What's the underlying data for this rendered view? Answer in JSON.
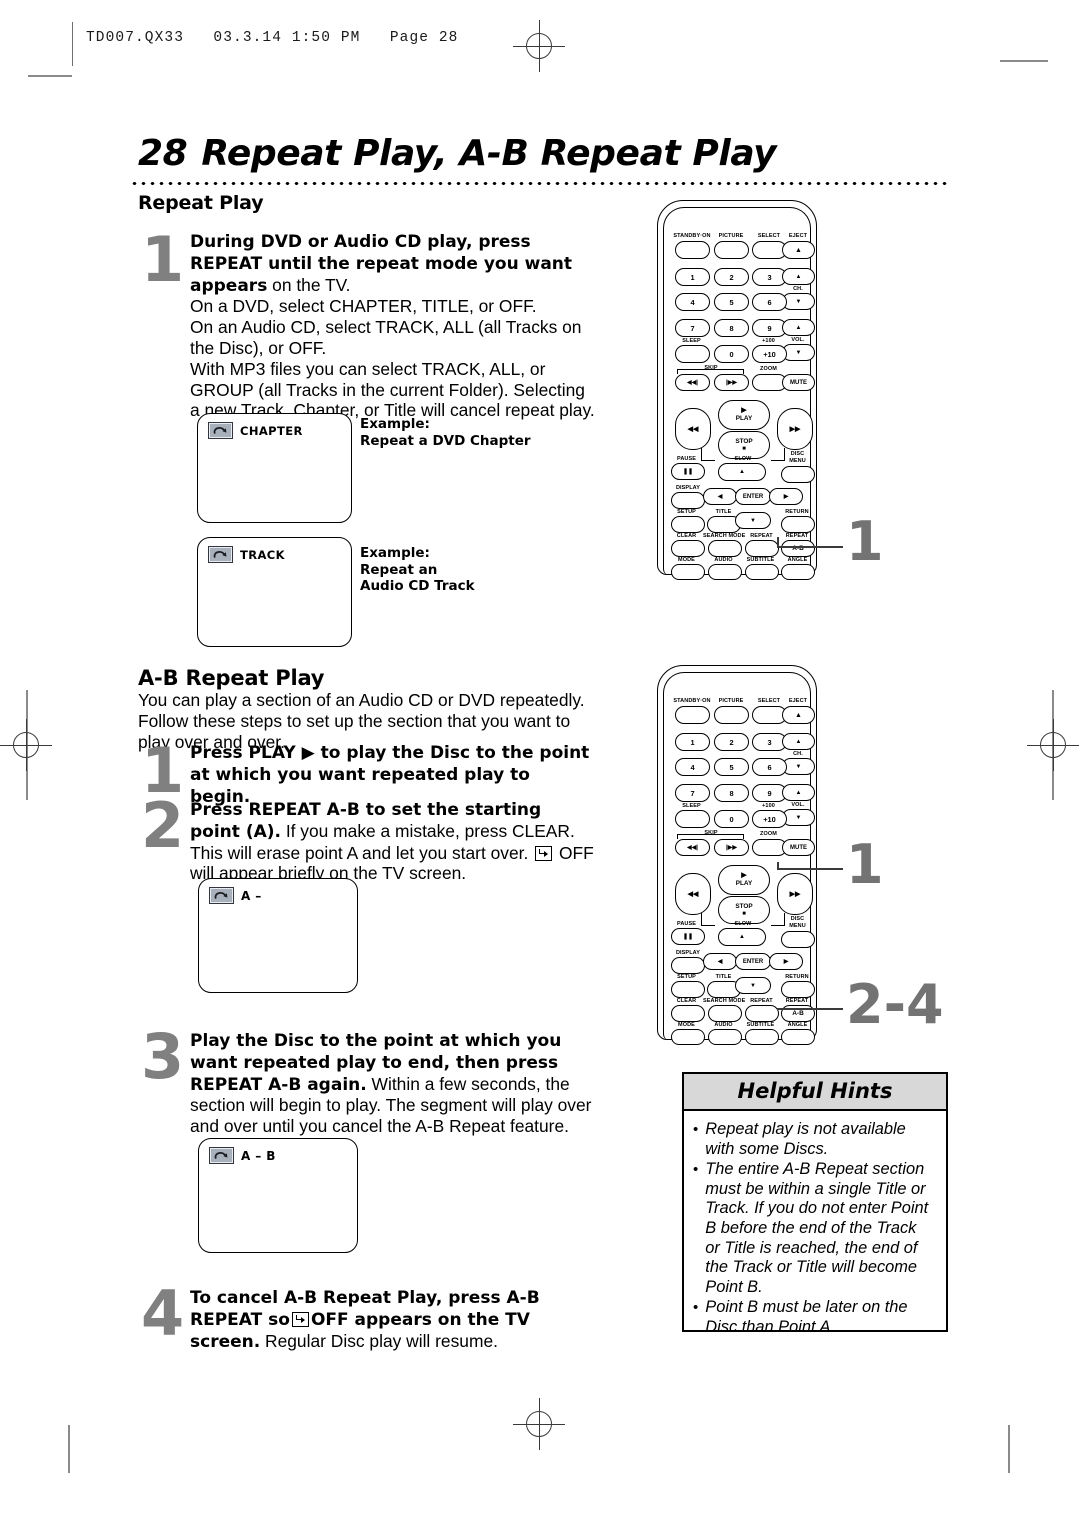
{
  "header": {
    "print_info": "TD007.QX33   03.3.14 1:50 PM   Page 28"
  },
  "page": {
    "number": "28",
    "title": "Repeat Play, A-B Repeat Play"
  },
  "sections": {
    "repeat_play": {
      "heading": "Repeat Play",
      "step1": {
        "number": "1",
        "bold_lead": "During DVD or Audio CD play, press REPEAT until the repeat mode you want appears",
        "rest": " on the TV.",
        "line2": "On a DVD, select CHAPTER, TITLE, or OFF.",
        "line3": "On an Audio CD, select TRACK,  ALL (all Tracks on the Disc), or OFF.",
        "line4": "With MP3 files you can select TRACK, ALL, or GROUP (all Tracks in the current Folder). Selecting a new Track, Chapter, or Title will cancel repeat play."
      },
      "screens": [
        {
          "icon": "repeat-icon",
          "osd_label": "CHAPTER",
          "caption_line1": "Example:",
          "caption_line2": "Repeat a DVD Chapter"
        },
        {
          "icon": "repeat-icon",
          "osd_label": "TRACK",
          "caption_line1": "Example:",
          "caption_line2": "Repeat an",
          "caption_line3": "Audio CD Track"
        }
      ]
    },
    "ab_repeat_play": {
      "heading": "A-B Repeat Play",
      "intro": "You can play a section of an Audio CD or DVD repeatedly. Follow these steps to set up the section that you want to play over and over.",
      "step1": {
        "number": "1",
        "bold_a": "Press PLAY",
        "bold_b": "to play the Disc to the point at which you want repeated play to begin."
      },
      "step2": {
        "number": "2",
        "bold_a": "Press REPEAT A-B to set the starting point (A).",
        "rest_a": " If you make a mistake, press CLEAR.  This will erase point A and let you start over. ",
        "rest_b": " OFF will appear briefly on the TV screen."
      },
      "step3": {
        "number": "3",
        "bold_a": "Play the Disc to the point at which you want repeated play to end, then press REPEAT A-B again.",
        "rest": "  Within a few seconds, the section will begin to play.  The segment will play over and over until you cancel the A-B Repeat feature."
      },
      "step4": {
        "number": "4",
        "bold_a": "To cancel A-B Repeat Play, press A-B REPEAT so",
        "bold_b": "OFF appears on the TV screen.",
        "rest": " Regular Disc play will resume."
      },
      "screens": [
        {
          "icon": "repeat-icon",
          "osd_label": "A –"
        },
        {
          "icon": "repeat-icon",
          "osd_label": "A – B"
        }
      ]
    }
  },
  "remote": {
    "callout_top": "1",
    "callout_mid": "1",
    "callout_bottom": "2-4",
    "labels": {
      "standby": "STANDBY·ON",
      "picture": "PICTURE",
      "select": "SELECT",
      "eject": "EJECT",
      "eject_glyph": "▲",
      "n1": "1",
      "n2": "2",
      "n3": "3",
      "n4": "4",
      "n5": "5",
      "n6": "6",
      "n7": "7",
      "n8": "8",
      "n9": "9",
      "n0": "0",
      "plus100": "+100",
      "plus10": "+10",
      "ch": "CH.",
      "vol": "VOL.",
      "up_glyph": "▲",
      "down_glyph": "▼",
      "left_glyph": "◀",
      "right_glyph": "▶",
      "sleep": "SLEEP",
      "skip": "SKIP",
      "skip_back": "◀◀|",
      "skip_fwd": "|▶▶",
      "zoom": "ZOOM",
      "mute": "MUTE",
      "play": "PLAY",
      "play_glyph": "▶",
      "stop": "STOP",
      "stop_glyph": "■",
      "rew_glyph": "◀◀",
      "ffwd_glyph": "▶▶",
      "pause": "PAUSE",
      "pause_glyph": "❚❚",
      "slow": "SLOW",
      "disc_menu_1": "DISC",
      "disc_menu_2": "MENU",
      "display": "DISPLAY",
      "enter": "ENTER",
      "setup": "SETUP",
      "title": "TITLE",
      "return": "RETURN",
      "clear": "CLEAR",
      "search_mode": "SEARCH MODE",
      "repeat": "REPEAT",
      "repeat_ab_top": "REPEAT",
      "repeat_ab": "A-B",
      "mode": "MODE",
      "audio": "AUDIO",
      "subtitle": "SUBTITLE",
      "angle": "ANGLE"
    }
  },
  "helpful_hints": {
    "title": "Helpful Hints",
    "bullet_char": "•",
    "items": [
      "Repeat play is not available with some Discs.",
      "The entire A-B Repeat section must be within a single Title or Track.  If you do not enter Point B before the end of the Track or Title is reached, the end of the Track or Title will become Point B.",
      "Point B must be later on the Disc than Point A."
    ]
  },
  "colors": {
    "step_numeral": "#808080",
    "callout": "#737373",
    "hints_header_bg": "#d8d8d8",
    "osd_icon_bg": "#a8b0bc"
  }
}
